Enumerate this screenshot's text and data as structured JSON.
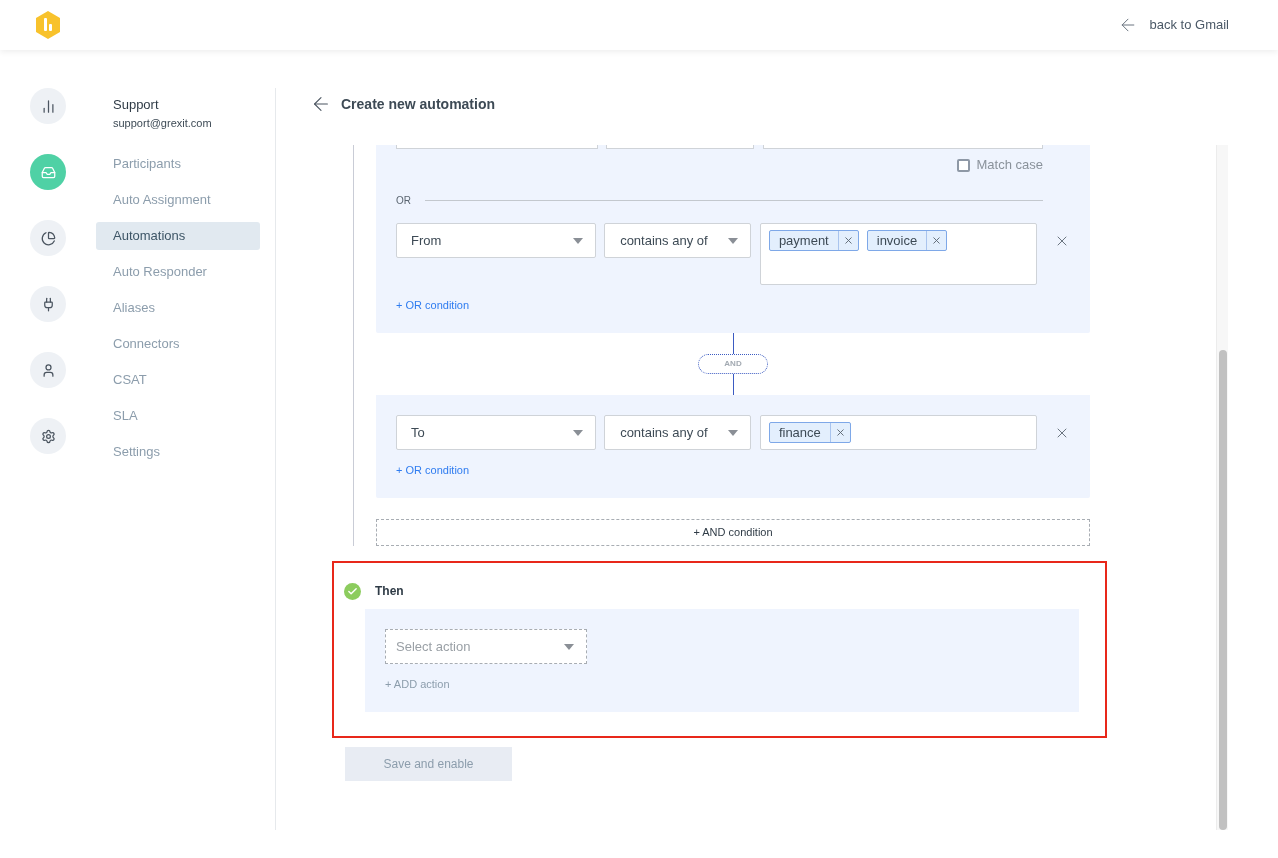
{
  "header": {
    "back_link": "back to Gmail"
  },
  "rail": [
    {
      "kind": "chart",
      "selected": false
    },
    {
      "kind": "inbox",
      "selected": true
    },
    {
      "kind": "pie",
      "selected": false
    },
    {
      "kind": "plug",
      "selected": false
    },
    {
      "kind": "user",
      "selected": false
    },
    {
      "kind": "gear",
      "selected": false
    }
  ],
  "sidebar": {
    "title": "Support",
    "email": "support@grexit.com",
    "items": [
      {
        "label": "Participants",
        "selected": false
      },
      {
        "label": "Auto Assignment",
        "selected": false
      },
      {
        "label": "Automations",
        "selected": true
      },
      {
        "label": "Auto Responder",
        "selected": false
      },
      {
        "label": "Aliases",
        "selected": false
      },
      {
        "label": "Connectors",
        "selected": false
      },
      {
        "label": "CSAT",
        "selected": false
      },
      {
        "label": "SLA",
        "selected": false
      },
      {
        "label": "Settings",
        "selected": false
      }
    ]
  },
  "page_title": "Create new automation",
  "condition_groups": [
    {
      "cut_off_top": true,
      "match_case": {
        "label": "Match case",
        "checked": false
      },
      "or_label": "OR",
      "rows": [
        {
          "field": "From",
          "operator": "contains any of",
          "tags": [
            "payment",
            "invoice"
          ]
        }
      ],
      "add_or": "+ OR condition"
    },
    {
      "cut_off_top": false,
      "rows": [
        {
          "field": "To",
          "operator": "contains any of",
          "tags": [
            "finance"
          ]
        }
      ],
      "add_or": "+ OR condition"
    }
  ],
  "connector": "AND",
  "add_and": "+ AND condition",
  "then": {
    "title": "Then",
    "done": true,
    "highlighted": true,
    "action_placeholder": "Select action",
    "add_action": "+ ADD action"
  },
  "save_button": {
    "label": "Save and enable",
    "disabled": true
  }
}
